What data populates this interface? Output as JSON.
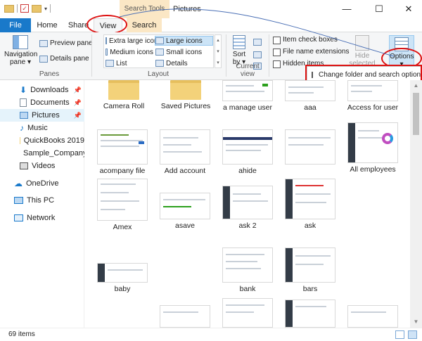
{
  "titlebar": {
    "context_tab_header": "Search Tools",
    "window_title": "Pictures",
    "minimize": "—",
    "maximize": "☐",
    "close": "✕"
  },
  "tabs": [
    {
      "label": "File"
    },
    {
      "label": "Home"
    },
    {
      "label": "Share"
    },
    {
      "label": "View"
    },
    {
      "label": "Search"
    }
  ],
  "ribbon": {
    "panes": {
      "navigation_pane": "Navigation",
      "navigation_pane_2": "pane ▾",
      "preview_pane": "Preview pane",
      "details_pane": "Details pane",
      "group_label": "Panes"
    },
    "layout": {
      "items": [
        {
          "label": "Extra large icons"
        },
        {
          "label": "Large icons"
        },
        {
          "label": "Medium icons"
        },
        {
          "label": "Small icons"
        },
        {
          "label": "List"
        },
        {
          "label": "Details"
        }
      ],
      "group_label": "Layout"
    },
    "current_view": {
      "sort_by": "Sort",
      "sort_by_2": "by ▾",
      "group_label": "Current view"
    },
    "show_hide": {
      "item_check_boxes": "Item check boxes",
      "file_name_extensions": "File name extensions",
      "hidden_items": "Hidden items",
      "hide_selected": "Hide selected",
      "hide_selected_2": "items"
    },
    "options": {
      "label": "Options",
      "arrow": "▾"
    }
  },
  "options_menu": {
    "change_folder_options": "Change folder and search options"
  },
  "nav": {
    "items": [
      {
        "label": "Downloads",
        "pinned": true
      },
      {
        "label": "Documents",
        "pinned": true
      },
      {
        "label": "Pictures",
        "pinned": true
      },
      {
        "label": "Music"
      },
      {
        "label": "QuickBooks 2019"
      },
      {
        "label": "Sample_Company_I"
      },
      {
        "label": "Videos"
      },
      {
        "label": "OneDrive"
      },
      {
        "label": "This PC"
      },
      {
        "label": "Network"
      }
    ],
    "pin_glyph": "📌"
  },
  "content": {
    "items": [
      {
        "label": "Camera Roll"
      },
      {
        "label": "Saved Pictures"
      },
      {
        "label": "a manage user"
      },
      {
        "label": "aaa"
      },
      {
        "label": "Access for user"
      },
      {
        "label": "acompany file"
      },
      {
        "label": "Add account"
      },
      {
        "label": "ahide"
      },
      {
        "label": ""
      },
      {
        "label": "All employees"
      },
      {
        "label": "Amex"
      },
      {
        "label": "asave"
      },
      {
        "label": "ask 2"
      },
      {
        "label": "ask"
      },
      {
        "label": "baby"
      },
      {
        "label": "bank"
      },
      {
        "label": "bars"
      }
    ]
  },
  "status": {
    "item_count": "69 items"
  },
  "colors": {
    "accent": "#1979ca",
    "annotation_red": "#d11111",
    "context_tab": "#fbe7c5"
  }
}
